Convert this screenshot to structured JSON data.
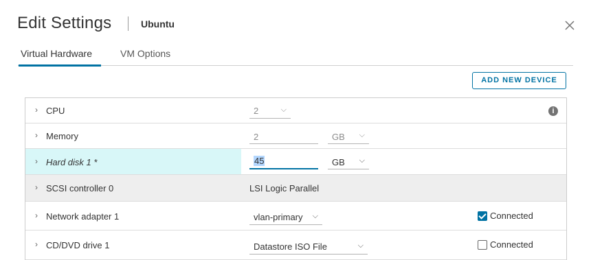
{
  "dialog": {
    "title": "Edit Settings",
    "vm_name": "Ubuntu",
    "close_icon": "close-icon"
  },
  "tabs": [
    {
      "label": "Virtual Hardware",
      "active": true
    },
    {
      "label": "VM Options",
      "active": false
    }
  ],
  "toolbar": {
    "add_device_label": "ADD NEW DEVICE"
  },
  "hardware": {
    "cpu": {
      "label": "CPU",
      "value": "2",
      "info_icon": "info-icon"
    },
    "memory": {
      "label": "Memory",
      "value": "2",
      "unit": "GB"
    },
    "hard_disk": {
      "label": "Hard disk 1 *",
      "value": "45",
      "unit": "GB"
    },
    "scsi": {
      "label": "SCSI controller 0",
      "value": "LSI Logic Parallel"
    },
    "network": {
      "label": "Network adapter 1",
      "value": "vlan-primary",
      "connected_label": "Connected",
      "connected": true
    },
    "cdrom": {
      "label": "CD/DVD drive 1",
      "value": "Datastore ISO File",
      "connected_label": "Connected",
      "connected": false
    }
  },
  "colors": {
    "accent": "#0072a3",
    "selected_row": "#d8f7f8",
    "gray_row": "#eeeeee"
  }
}
